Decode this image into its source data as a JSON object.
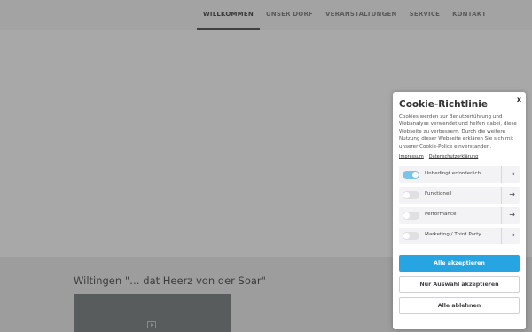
{
  "nav": {
    "items": [
      {
        "label": "WILLKOMMEN",
        "active": true
      },
      {
        "label": "UNSER DORF",
        "active": false
      },
      {
        "label": "VERANSTALTUNGEN",
        "active": false
      },
      {
        "label": "SERVICE",
        "active": false
      },
      {
        "label": "KONTAKT",
        "active": false
      }
    ]
  },
  "main": {
    "section_title": "Wiltingen \"… dat Heerz von der Soar\"",
    "video_icon": "play-icon"
  },
  "cookie": {
    "close_label": "x",
    "title": "Cookie-Richtlinie",
    "text": "Cookies werden zur Benutzerführung und Webanalyse verwendet und helfen dabei, diese Webseite zu verbessern. Durch die weitere Nutzung dieser Webseite erklären Sie sich mit unserer Cookie-Police einverstanden.",
    "links": {
      "impressum": "Impressum",
      "datenschutz": "Datenschutzerklärung"
    },
    "categories": [
      {
        "label": "Unbedingt erforderlich",
        "enabled": true,
        "arrow": "→"
      },
      {
        "label": "Funktionell",
        "enabled": false,
        "arrow": "→"
      },
      {
        "label": "Performance",
        "enabled": false,
        "arrow": "→"
      },
      {
        "label": "Marketing / Third Party",
        "enabled": false,
        "arrow": "→"
      }
    ],
    "buttons": {
      "accept_all": "Alle akzeptieren",
      "accept_selection": "Nur Auswahl akzeptieren",
      "reject_all": "Alle ablehnen"
    },
    "colors": {
      "accent": "#26a5e2",
      "toggle_on": "#7cc3e8"
    }
  }
}
